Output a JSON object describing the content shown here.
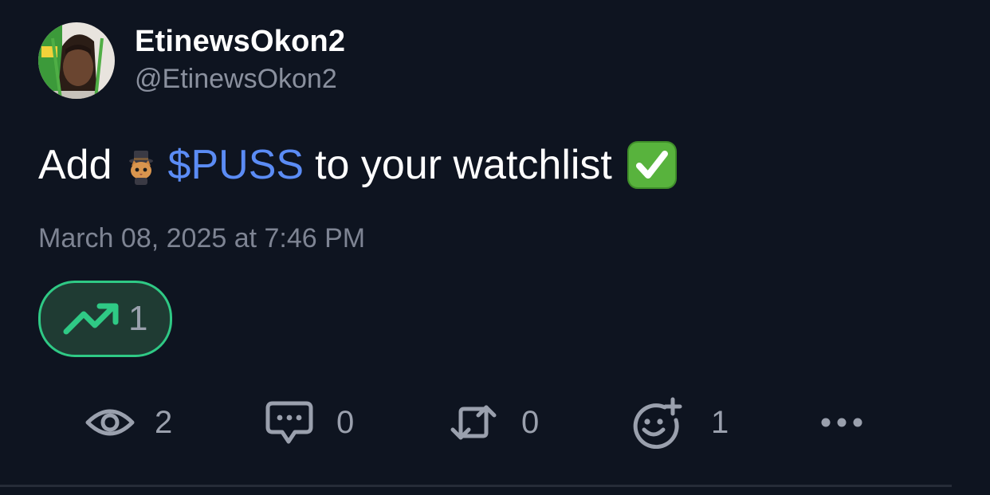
{
  "post": {
    "author": {
      "display_name": "EtinewsOkon2",
      "handle": "@EtinewsOkon2"
    },
    "text": {
      "prefix": "Add",
      "cashtag": "$PUSS",
      "suffix": "to your watchlist"
    },
    "timestamp": "March 08, 2025 at 7:46 PM",
    "trend": {
      "icon": "trending-up-icon",
      "count": "1",
      "accent_color": "#2fc985"
    },
    "actions": {
      "views": {
        "icon": "eye-icon",
        "count": "2"
      },
      "comments": {
        "icon": "comment-icon",
        "count": "0"
      },
      "reposts": {
        "icon": "repost-icon",
        "count": "0"
      },
      "reactions": {
        "icon": "add-reaction-icon",
        "count": "1"
      },
      "more": {
        "icon": "more-icon"
      }
    },
    "colors": {
      "background": "#0e1420",
      "cashtag": "#5b8cf5",
      "muted_text": "#8a909e"
    }
  }
}
